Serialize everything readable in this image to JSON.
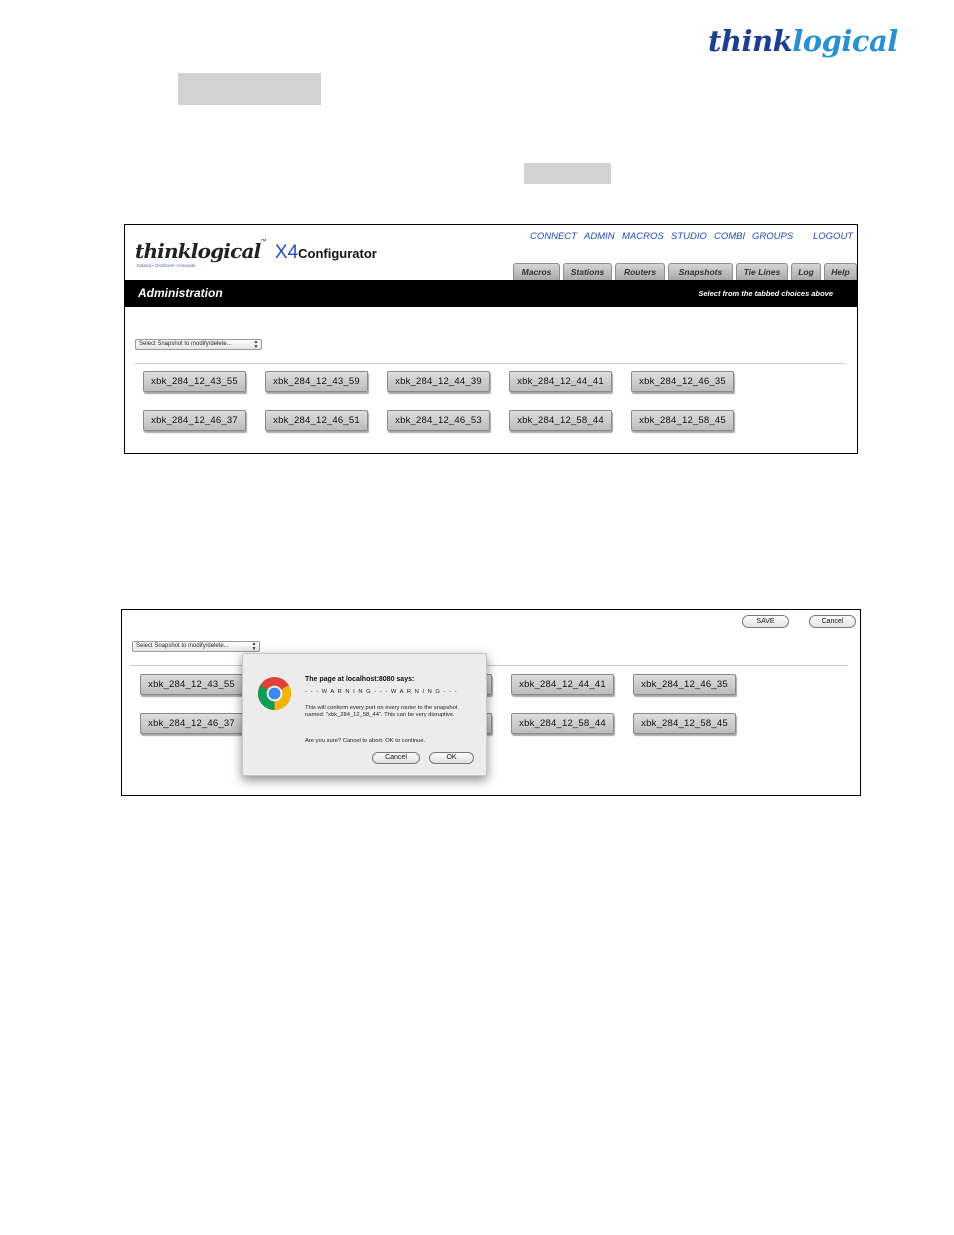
{
  "header": {
    "logo_think": "think",
    "logo_logical": "logical"
  },
  "screen1": {
    "brand": "thinklogical",
    "brand_tm": "™",
    "product": "X4",
    "product_suffix": "Configurator",
    "tagline": "Extend • Distribute • Innovate",
    "topnav": [
      "CONNECT",
      "ADMIN",
      "MACROS",
      "STUDIO",
      "COMBI",
      "GROUPS",
      "LOGOUT"
    ],
    "tabs": [
      "Macros",
      "Stations",
      "Routers",
      "Snapshots",
      "Tie Lines",
      "Log",
      "Help"
    ],
    "section_title": "Administration",
    "section_hint": "Select from the tabbed choices above",
    "snapshot_select": "Select Snapshot to modify/delete...",
    "snapshots": [
      "xbk_284_12_43_55",
      "xbk_284_12_43_59",
      "xbk_284_12_44_39",
      "xbk_284_12_44_41",
      "xbk_284_12_46_35",
      "xbk_284_12_46_37",
      "xbk_284_12_46_51",
      "xbk_284_12_46_53",
      "xbk_284_12_58_44",
      "xbk_284_12_58_45"
    ]
  },
  "screen2": {
    "save_label": "SAVE",
    "cancel_label": "Cancel",
    "snapshot_select": "Select Snapshot to modify/delete...",
    "snapshots_left": [
      "xbk_284_12_43_55",
      "xbk_284_12_46_37"
    ],
    "snapshots_right": [
      "xbk_284_12_44_41",
      "xbk_284_12_46_35",
      "xbk_284_12_58_44",
      "xbk_284_12_58_45"
    ],
    "dialog": {
      "title": "The page at localhost:8080 says:",
      "warning": "- - - W A R N I N G - - - W A R N I N G - - -",
      "message": "This will conform every port on every router to the snapshot named: \"xbk_284_12_58_44\". This can be very disruptive.",
      "confirm": "Are you sure?  Cancel to abort. OK to continue.",
      "cancel_label": "Cancel",
      "ok_label": "OK"
    }
  },
  "colors": {
    "brand_dark_blue": "#1d3f8f",
    "brand_light_blue": "#2b8fd0",
    "nav_link_blue": "#1b4fc0",
    "title_bar": "#000000",
    "redaction_gray": "#d2d2d2"
  }
}
